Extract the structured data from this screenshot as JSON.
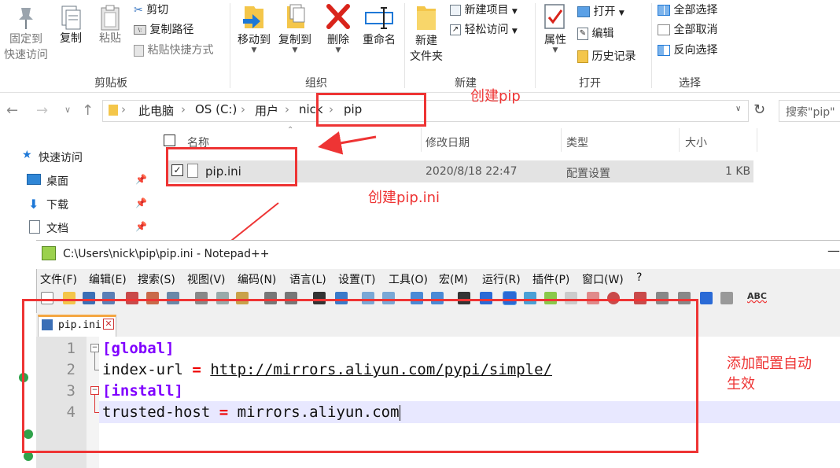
{
  "ribbon": {
    "clipboard": {
      "pin": "固定到\n快速访问",
      "copy": "复制",
      "paste": "粘贴",
      "cut": "剪切",
      "copy_path": "复制路径",
      "paste_shortcut": "粘贴快捷方式",
      "group": "剪贴板"
    },
    "organize": {
      "move_to": "移动到",
      "copy_to": "复制到",
      "delete": "删除",
      "rename": "重命名",
      "group": "组织"
    },
    "new": {
      "new_folder": "新建\n文件夹",
      "new_item": "新建项目",
      "easy_access": "轻松访问",
      "group": "新建"
    },
    "open": {
      "properties": "属性",
      "open": "打开",
      "edit": "编辑",
      "history": "历史记录",
      "group": "打开"
    },
    "select": {
      "select_all": "全部选择",
      "select_none": "全部取消",
      "invert": "反向选择",
      "group": "选择"
    }
  },
  "address": {
    "crumbs": [
      "此电脑",
      "OS (C:)",
      "用户",
      "nick",
      "pip"
    ],
    "search_placeholder": "搜索\"pip\""
  },
  "nav": {
    "quick_access": "快速访问",
    "items": [
      "桌面",
      "下载",
      "文档"
    ]
  },
  "columns": {
    "name": "名称",
    "date": "修改日期",
    "type": "类型",
    "size": "大小"
  },
  "file_row": {
    "name": "pip.ini",
    "date": "2020/8/18 22:47",
    "type": "配置设置",
    "size": "1 KB"
  },
  "annotations": {
    "create_pip": "创建pip",
    "create_pip_ini": "创建pip.ini",
    "auto_effect_line1": "添加配置自动",
    "auto_effect_line2": "生效"
  },
  "notepad": {
    "title": "C:\\Users\\nick\\pip\\pip.ini - Notepad++",
    "menus": [
      "文件(F)",
      "编辑(E)",
      "搜索(S)",
      "视图(V)",
      "编码(N)",
      "语言(L)",
      "设置(T)",
      "工具(O)",
      "宏(M)",
      "运行(R)",
      "插件(P)",
      "窗口(W)",
      "?"
    ],
    "tab_label": "pip.ini",
    "spell_label": "ABC",
    "line_numbers": [
      "1",
      "2",
      "3",
      "4"
    ],
    "lines": [
      {
        "section": "[global]"
      },
      {
        "key": "index-url",
        "eq": "=",
        "value": "http://mirrors.aliyun.com/pypi/simple/"
      },
      {
        "section": "[install]"
      },
      {
        "key": "trusted-host",
        "eq": "=",
        "value": "mirrors.aliyun.com"
      }
    ]
  },
  "colors": {
    "accent_red": "#ee3434",
    "section_purple": "#8000ff",
    "tab_orange": "#f4a641",
    "folder_yellow": "#f4c64a",
    "explorer_blue": "#1e78d7"
  }
}
